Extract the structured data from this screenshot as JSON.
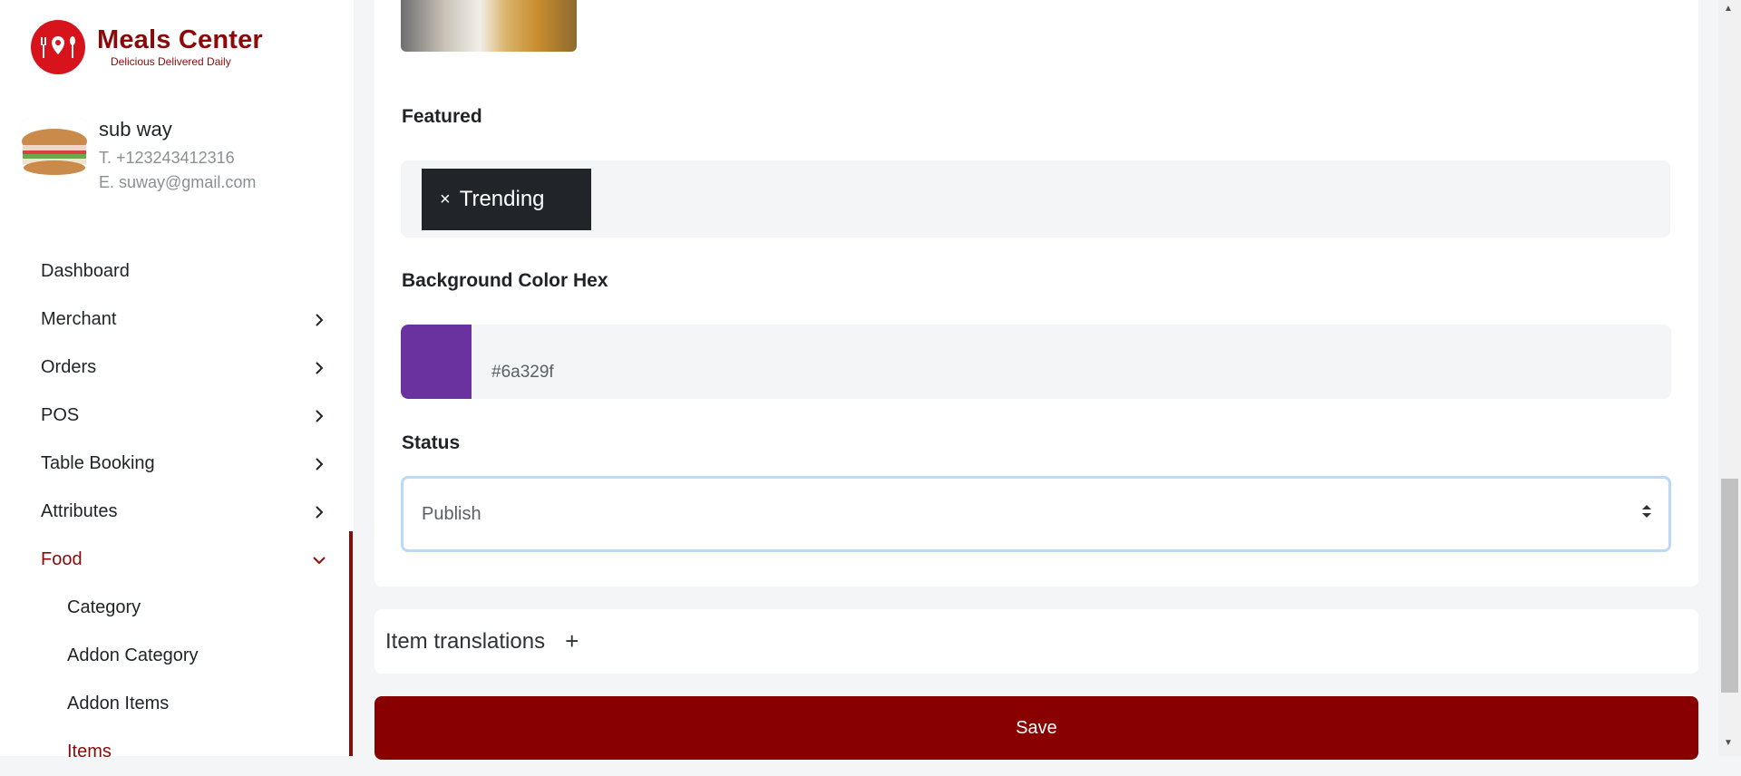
{
  "brand": {
    "title": "Meals Center",
    "tagline": "Delicious Delivered Daily",
    "color": "#8a0a0a",
    "logo_bg": "#d7131c"
  },
  "profile": {
    "name": "sub way",
    "phone": "T. +123243412316",
    "email": "E. suway@gmail.com"
  },
  "nav": {
    "dashboard": "Dashboard",
    "merchant": "Merchant",
    "orders": "Orders",
    "pos": "POS",
    "table_booking": "Table Booking",
    "attributes": "Attributes",
    "food": "Food",
    "food_sub": {
      "category": "Category",
      "addon_category": "Addon Category",
      "addon_items": "Addon Items",
      "items": "Items"
    }
  },
  "form": {
    "featured_label": "Featured",
    "featured_tags": [
      "Trending"
    ],
    "tag_remove": "×",
    "bg_color_label": "Background Color Hex",
    "bg_color_value": "#6a329f",
    "status_label": "Status",
    "status_value": "Publish"
  },
  "translations": {
    "label": "Item translations",
    "add": "+"
  },
  "actions": {
    "save": "Save"
  },
  "colors": {
    "save_bg": "#890000",
    "tag_bg": "#212529",
    "swatch": "#6a329f"
  }
}
